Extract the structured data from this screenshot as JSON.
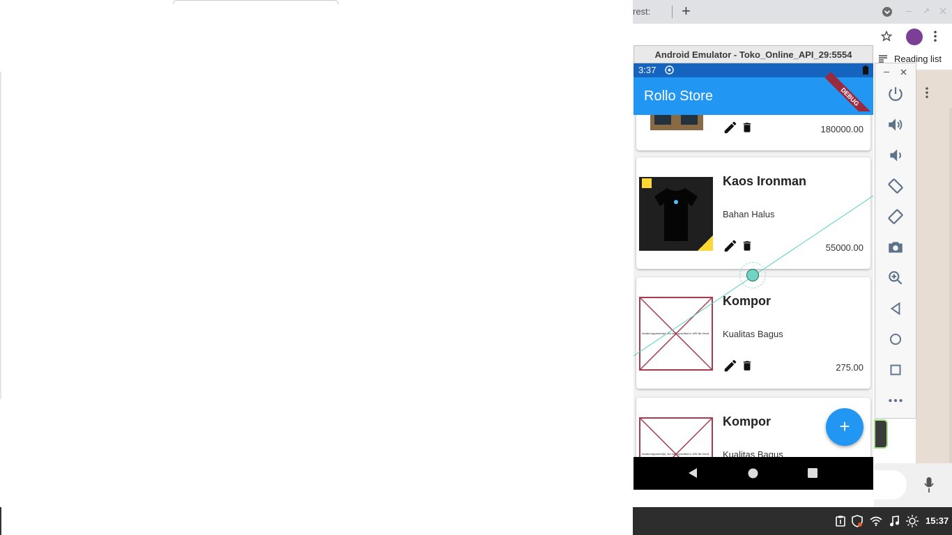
{
  "browser": {
    "tab_partial_text": "rest:",
    "bookmark_reading_list": "Reading list",
    "new_tab_symbol": "+"
  },
  "emulator": {
    "title": "Android Emulator - Toko_Online_API_29:5554",
    "status_time": "3:37",
    "debug_banner": "DEBUG",
    "app_title": "Rollo Store",
    "partial_card_price": "180000.00",
    "cards": [
      {
        "title": "Kaos Ironman",
        "description": "Bahan Halus",
        "price": "55000.00",
        "image_error": ""
      },
      {
        "title": "Kompor",
        "description": "Kualitas Bagus",
        "price": "275.00",
        "image_error": "Invalid argument(s): No host specified in URI file:///null"
      },
      {
        "title": "Kompor",
        "description": "Kualitas Bagus",
        "price": "",
        "image_error": "Invalid argument(s): No host specified in URI file:///null"
      }
    ],
    "fab_label": "+"
  },
  "taskbar": {
    "clock": "15:37"
  },
  "colors": {
    "appbar": "#2196f3",
    "statusbar": "#1565c0",
    "error_box": "#a83a4e",
    "accent_teal": "#4dd0c0"
  }
}
